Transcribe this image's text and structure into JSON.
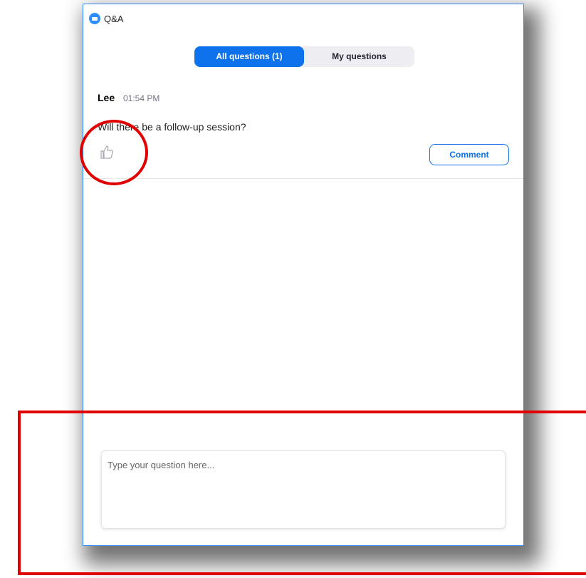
{
  "window": {
    "title": "Q&A",
    "accent_color": "#2d8cff",
    "app_icon": "zoom-camera-icon"
  },
  "tabs": [
    {
      "label": "All questions (1)",
      "active": true
    },
    {
      "label": "My questions",
      "active": false
    }
  ],
  "question": {
    "author": "Lee",
    "time": "01:54 PM",
    "text": "Will there be a follow-up session?",
    "upvote_icon": "thumbs-up-icon",
    "comment_label": "Comment"
  },
  "input": {
    "placeholder": "Type your question here..."
  },
  "annotations": {
    "color": "#e00000"
  }
}
